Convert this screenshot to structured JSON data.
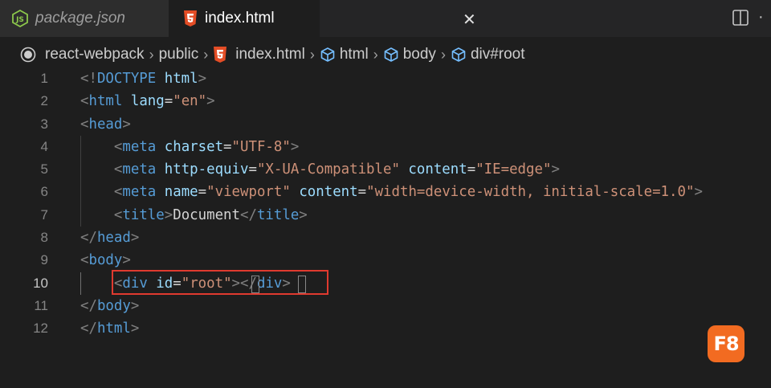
{
  "tabs": [
    {
      "label": "package.json",
      "icon": "nodejs-icon",
      "active": false
    },
    {
      "label": "index.html",
      "icon": "html5-icon",
      "active": true
    }
  ],
  "breadcrumb": {
    "root": "react-webpack",
    "folder": "public",
    "file": "index.html",
    "symbols": [
      "html",
      "body",
      "div#root"
    ]
  },
  "editor": {
    "current_line": 10,
    "lines": [
      {
        "n": "1",
        "tokens": [
          [
            "punc",
            "<!"
          ],
          [
            "tag",
            "DOCTYPE"
          ],
          [
            "plain",
            " "
          ],
          [
            "attr",
            "html"
          ],
          [
            "punc",
            ">"
          ]
        ]
      },
      {
        "n": "2",
        "tokens": [
          [
            "punc",
            "<"
          ],
          [
            "tag",
            "html"
          ],
          [
            "plain",
            " "
          ],
          [
            "attr",
            "lang"
          ],
          [
            "plain",
            "="
          ],
          [
            "str",
            "\"en\""
          ],
          [
            "punc",
            ">"
          ]
        ]
      },
      {
        "n": "3",
        "tokens": [
          [
            "punc",
            "<"
          ],
          [
            "tag",
            "head"
          ],
          [
            "punc",
            ">"
          ]
        ]
      },
      {
        "n": "4",
        "tokens": [
          [
            "plain",
            "    "
          ],
          [
            "punc",
            "<"
          ],
          [
            "tag",
            "meta"
          ],
          [
            "plain",
            " "
          ],
          [
            "attr",
            "charset"
          ],
          [
            "plain",
            "="
          ],
          [
            "str",
            "\"UTF-8\""
          ],
          [
            "punc",
            ">"
          ]
        ]
      },
      {
        "n": "5",
        "tokens": [
          [
            "plain",
            "    "
          ],
          [
            "punc",
            "<"
          ],
          [
            "tag",
            "meta"
          ],
          [
            "plain",
            " "
          ],
          [
            "attr",
            "http-equiv"
          ],
          [
            "plain",
            "="
          ],
          [
            "str",
            "\"X-UA-Compatible\""
          ],
          [
            "plain",
            " "
          ],
          [
            "attr",
            "content"
          ],
          [
            "plain",
            "="
          ],
          [
            "str",
            "\"IE=edge\""
          ],
          [
            "punc",
            ">"
          ]
        ]
      },
      {
        "n": "6",
        "tokens": [
          [
            "plain",
            "    "
          ],
          [
            "punc",
            "<"
          ],
          [
            "tag",
            "meta"
          ],
          [
            "plain",
            " "
          ],
          [
            "attr",
            "name"
          ],
          [
            "plain",
            "="
          ],
          [
            "str",
            "\"viewport\""
          ],
          [
            "plain",
            " "
          ],
          [
            "attr",
            "content"
          ],
          [
            "plain",
            "="
          ],
          [
            "str",
            "\"width=device-width, initial-scale=1.0\""
          ],
          [
            "punc",
            ">"
          ]
        ]
      },
      {
        "n": "7",
        "tokens": [
          [
            "plain",
            "    "
          ],
          [
            "punc",
            "<"
          ],
          [
            "tag",
            "title"
          ],
          [
            "punc",
            ">"
          ],
          [
            "plain",
            "Document"
          ],
          [
            "punc",
            "</"
          ],
          [
            "tag",
            "title"
          ],
          [
            "punc",
            ">"
          ]
        ]
      },
      {
        "n": "8",
        "tokens": [
          [
            "punc",
            "</"
          ],
          [
            "tag",
            "head"
          ],
          [
            "punc",
            ">"
          ]
        ]
      },
      {
        "n": "9",
        "tokens": [
          [
            "punc",
            "<"
          ],
          [
            "tag",
            "body"
          ],
          [
            "punc",
            ">"
          ]
        ]
      },
      {
        "n": "10",
        "tokens": [
          [
            "plain",
            "    "
          ],
          [
            "punc",
            "<"
          ],
          [
            "tag",
            "div"
          ],
          [
            "plain",
            " "
          ],
          [
            "attr",
            "id"
          ],
          [
            "plain",
            "="
          ],
          [
            "str",
            "\"root\""
          ],
          [
            "punc",
            ">"
          ],
          [
            "punc",
            "</"
          ],
          [
            "tag",
            "div"
          ],
          [
            "punc",
            ">"
          ]
        ]
      },
      {
        "n": "11",
        "tokens": [
          [
            "punc",
            "</"
          ],
          [
            "tag",
            "body"
          ],
          [
            "punc",
            ">"
          ]
        ]
      },
      {
        "n": "12",
        "tokens": [
          [
            "punc",
            "</"
          ],
          [
            "tag",
            "html"
          ],
          [
            "punc",
            ">"
          ]
        ]
      }
    ]
  },
  "brand_logo": {
    "text": "F8",
    "color": "#f26b21"
  },
  "colors": {
    "highlight_border": "#e03a2f",
    "tag": "#569cd6",
    "attr": "#9cdcfe",
    "string": "#ce9178"
  }
}
